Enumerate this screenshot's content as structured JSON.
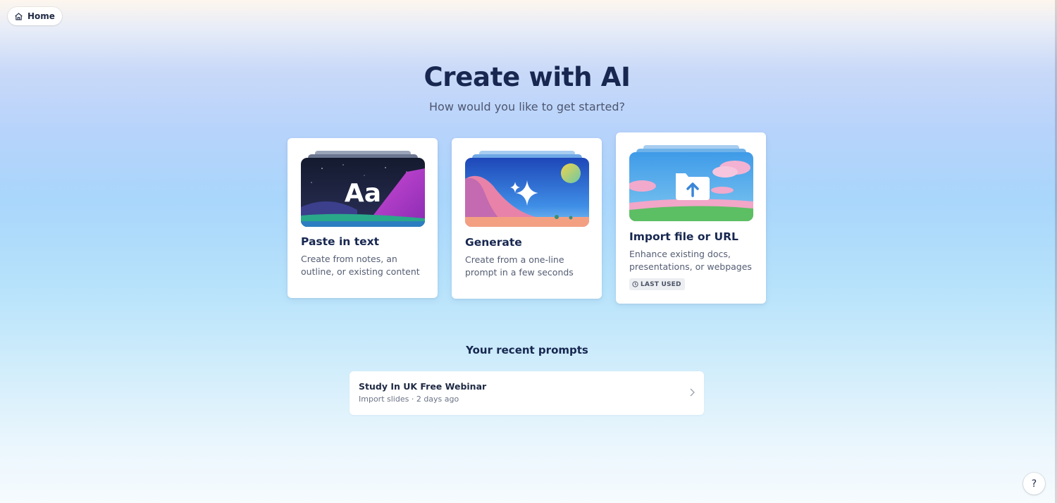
{
  "nav": {
    "home_label": "Home"
  },
  "header": {
    "title": "Create with AI",
    "subtitle": "How would you like to get started?"
  },
  "cards": [
    {
      "title": "Paste in text",
      "description": "Create from notes, an outline, or existing content",
      "icon": "text-aa-icon"
    },
    {
      "title": "Generate",
      "description": "Create from a one-line prompt in a few seconds",
      "icon": "sparkle-icon"
    },
    {
      "title": "Import file or URL",
      "description": "Enhance existing docs, presentations, or webpages",
      "icon": "upload-folder-icon",
      "badge": "LAST USED"
    }
  ],
  "art": {
    "aa_text": "Aa"
  },
  "recent": {
    "heading": "Your recent prompts",
    "items": [
      {
        "title": "Study In UK Free Webinar",
        "meta": "Import slides · 2 days ago"
      }
    ]
  },
  "help": {
    "label": "?"
  },
  "colors": {
    "heading": "#172750",
    "accent_purple": "#b53fd4",
    "accent_blue": "#2f7ad8"
  }
}
